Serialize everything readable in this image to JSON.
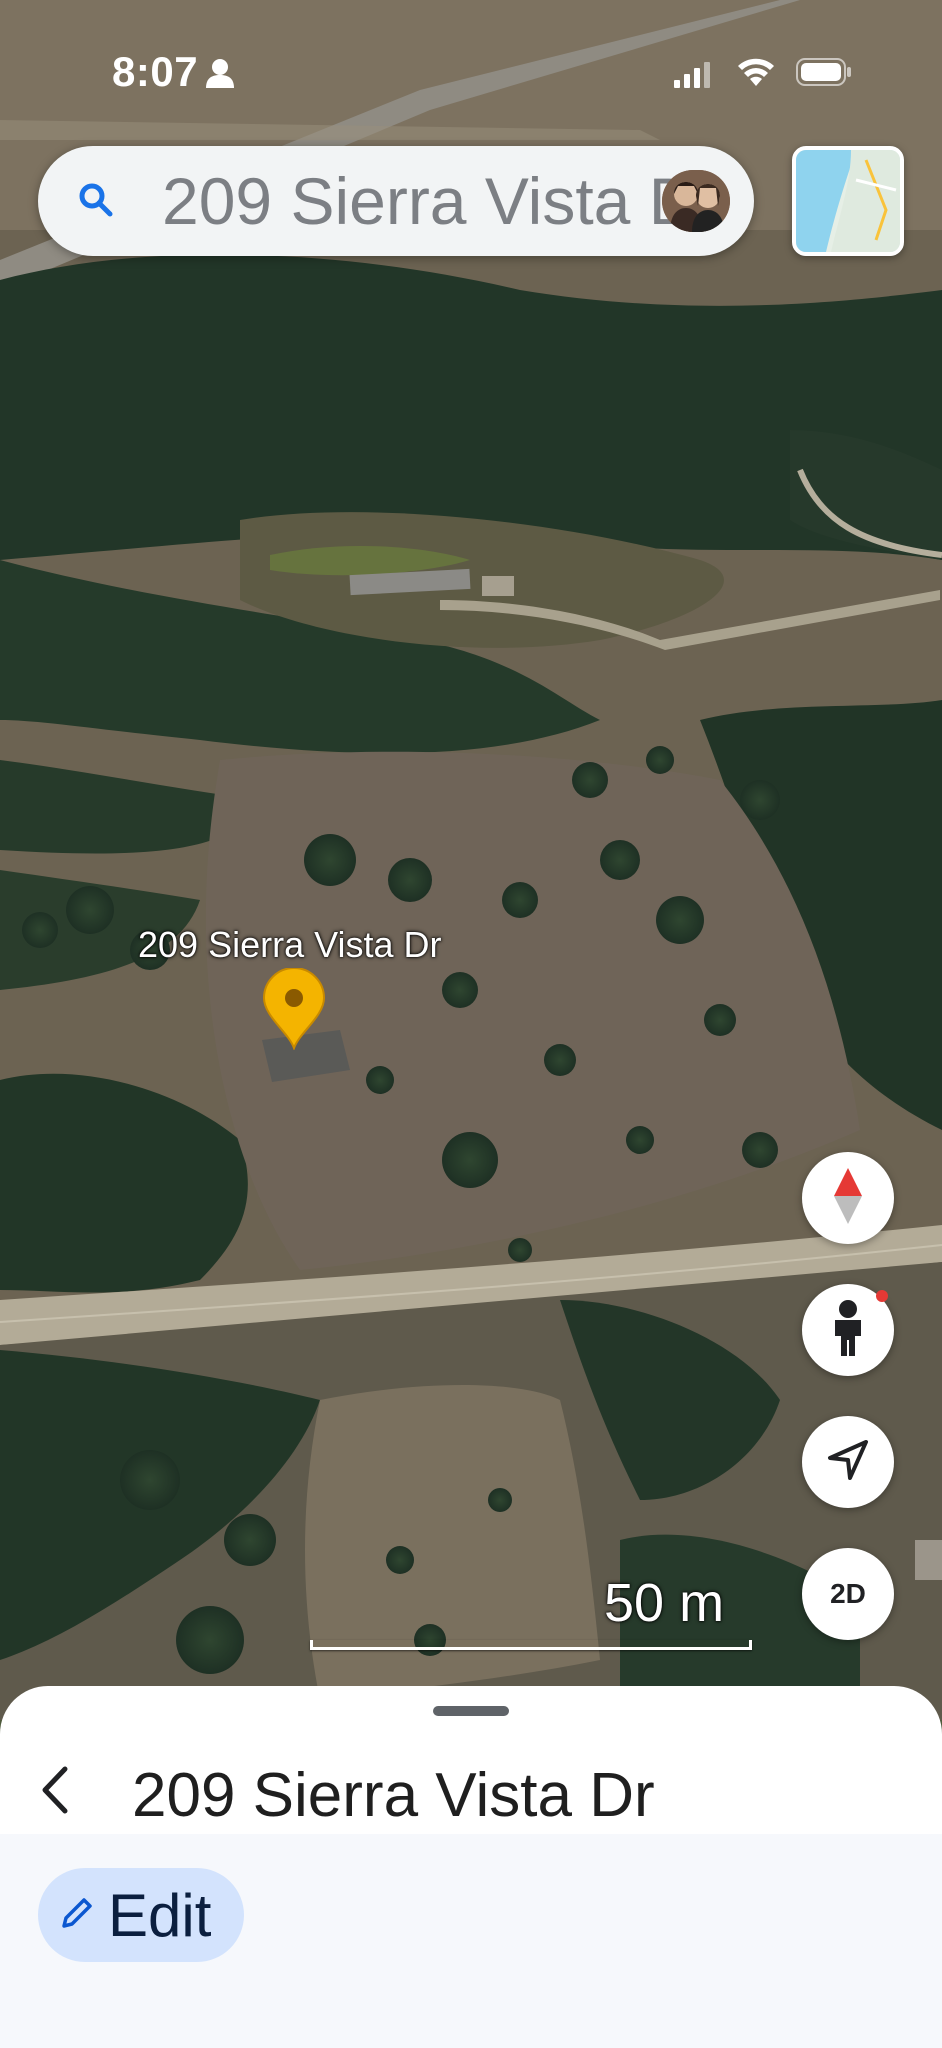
{
  "status_bar": {
    "time": "8:07",
    "icons": [
      "person-icon",
      "cellular-signal-icon",
      "wifi-icon",
      "battery-icon"
    ]
  },
  "search": {
    "query": "209 Sierra Vista Dr",
    "icon": "search-icon",
    "avatar": "profile-avatar"
  },
  "map": {
    "view": "satellite-3d",
    "place_label": "209 Sierra Vista Dr",
    "pin_color": "#f4b400",
    "scale_label": "50 m"
  },
  "controls": {
    "compass_icon": "compass-icon",
    "street_view_icon": "pegman-icon",
    "location_icon": "navigation-arrow-icon",
    "view_toggle_label": "2D"
  },
  "sheet": {
    "title": "209 Sierra Vista Dr",
    "back_icon": "chevron-left-icon",
    "edit_label": "Edit",
    "edit_icon": "pencil-icon",
    "accent": "#d3e3fd"
  }
}
